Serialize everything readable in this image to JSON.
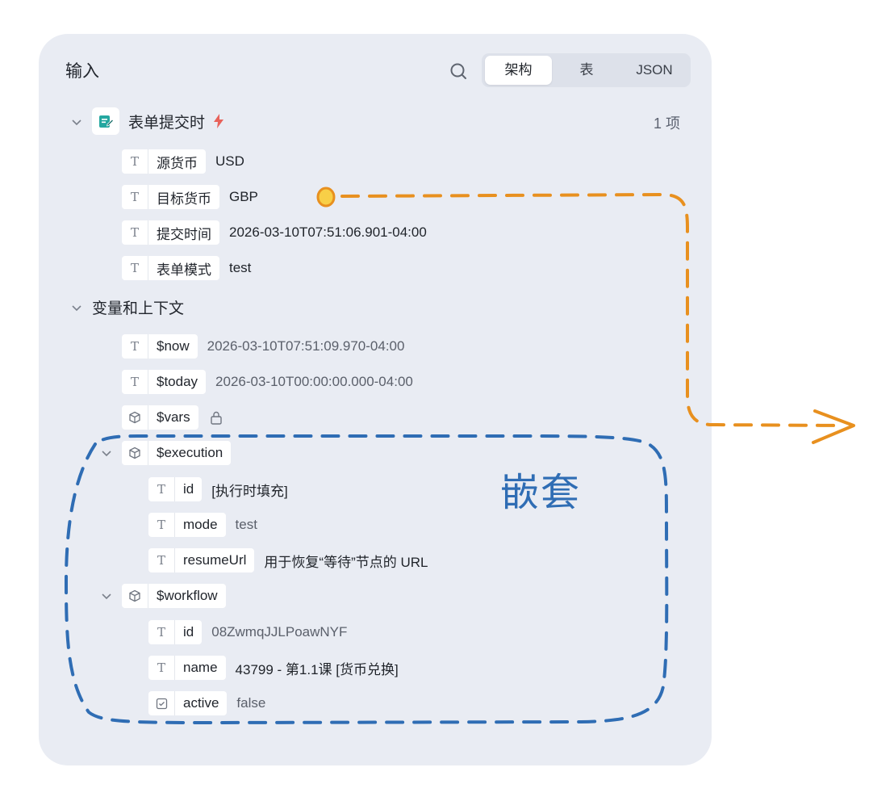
{
  "panel": {
    "title": "输入",
    "view_tabs": [
      {
        "label": "架构",
        "active": true
      },
      {
        "label": "表",
        "active": false
      },
      {
        "label": "JSON",
        "active": false
      }
    ]
  },
  "trigger_group": {
    "label": "表单提交时",
    "count": "1 项",
    "fields": [
      {
        "name": "源货币",
        "value": "USD"
      },
      {
        "name": "目标货币",
        "value": "GBP"
      },
      {
        "name": "提交时间",
        "value": "2026-03-10T07:51:06.901-04:00"
      },
      {
        "name": "表单模式",
        "value": "test"
      }
    ]
  },
  "vars_group": {
    "label": "变量和上下文",
    "now": {
      "name": "$now",
      "value": "2026-03-10T07:51:09.970-04:00"
    },
    "today": {
      "name": "$today",
      "value": "2026-03-10T00:00:00.000-04:00"
    },
    "vars": {
      "name": "$vars"
    },
    "execution": {
      "name": "$execution",
      "fields": [
        {
          "name": "id",
          "value": "[执行时填充]"
        },
        {
          "name": "mode",
          "value": "test"
        },
        {
          "name": "resumeUrl",
          "value": "用于恢复“等待”节点的 URL"
        }
      ]
    },
    "workflow": {
      "name": "$workflow",
      "fields": [
        {
          "name": "id",
          "value": "08ZwmqJJLPoawNYF"
        },
        {
          "name": "name",
          "value": "43799 - 第1.1课 [货币兑换]"
        },
        {
          "name": "active",
          "value": "false"
        }
      ]
    }
  },
  "annotation": {
    "nested_label": "嵌套",
    "colors": {
      "nested": "#2f6db4",
      "arrow": "#e8901f"
    }
  },
  "icons": {
    "search": "search-icon",
    "text_type": "T",
    "object_type": "cube-icon",
    "boolean_type": "checkbox-icon",
    "lock": "lock-icon",
    "trigger": "form-trigger-icon",
    "bolt": "lightning-icon"
  }
}
